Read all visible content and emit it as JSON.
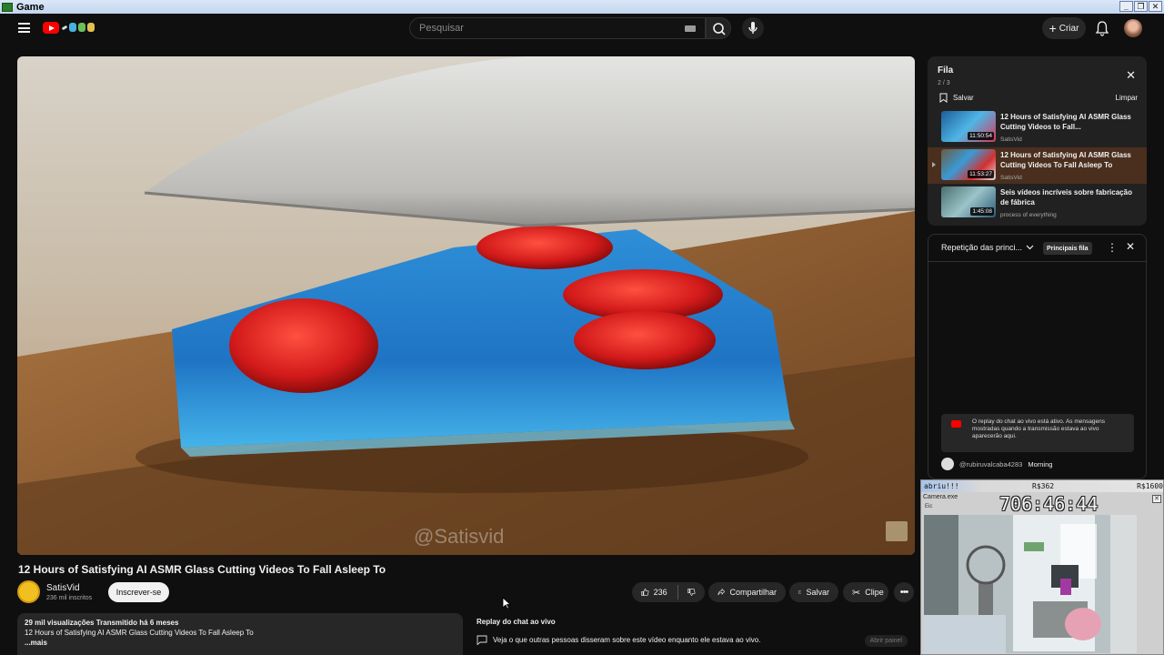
{
  "window": {
    "title": "Game",
    "buttons": [
      "_",
      "❐",
      "✕"
    ]
  },
  "masthead": {
    "search_placeholder": "Pesquisar",
    "create_label": "Criar"
  },
  "video": {
    "watermark": "@Satisvid",
    "title": "12 Hours of Satisfying AI ASMR Glass Cutting Videos To Fall Asleep To",
    "channel": "SatisVid",
    "subscribers": "236 mil inscritos",
    "subscribe_label": "Inscrever-se",
    "likes": "236",
    "share_label": "Compartilhar",
    "save_label": "Salvar",
    "clip_label": "Clipe"
  },
  "description": {
    "stats": "29 mil visualizações  Transmitido há 6 meses",
    "text": "12 Hours of Satisfying AI ASMR Glass Cutting Videos To Fall Asleep To",
    "more": "...mais"
  },
  "chat_replay_panel": {
    "title": "Replay do chat ao vivo",
    "text": "Veja o que outras pessoas disseram sobre este vídeo enquanto ele estava ao vivo.",
    "open_label": "Abrir painel"
  },
  "queue": {
    "title": "Fila",
    "count": "2 / 3",
    "save_label": "Salvar",
    "clear_label": "Limpar",
    "items": [
      {
        "title": "12 Hours of Satisfying AI ASMR Glass Cutting Videos to Fall...",
        "channel": "SatisVid",
        "duration": "11:50:54",
        "active": false
      },
      {
        "title": "12 Hours of Satisfying AI ASMR Glass Cutting Videos To Fall Asleep To",
        "channel": "SatisVid",
        "duration": "11:53:27",
        "active": true
      },
      {
        "title": "Seis vídeos incríveis sobre fabricação de fábrica",
        "channel": "process of everything",
        "duration": "1:45:08",
        "active": false
      }
    ]
  },
  "live_chat": {
    "mode": "Repetição das princi...",
    "tag": "Principais fila",
    "notice": "O replay do chat ao vivo está ativo. As mensagens mostradas quando a transmissão estava ao vivo aparecerão aqui.",
    "message_user": "@rubiruvalcaba4283",
    "message_text": "Morning"
  },
  "overlay": {
    "label": "abriu!!!",
    "value1": "R$362",
    "value2": "R$1600",
    "title": "Camera.exe",
    "sub": "Eic",
    "timer": "706:46:44"
  }
}
